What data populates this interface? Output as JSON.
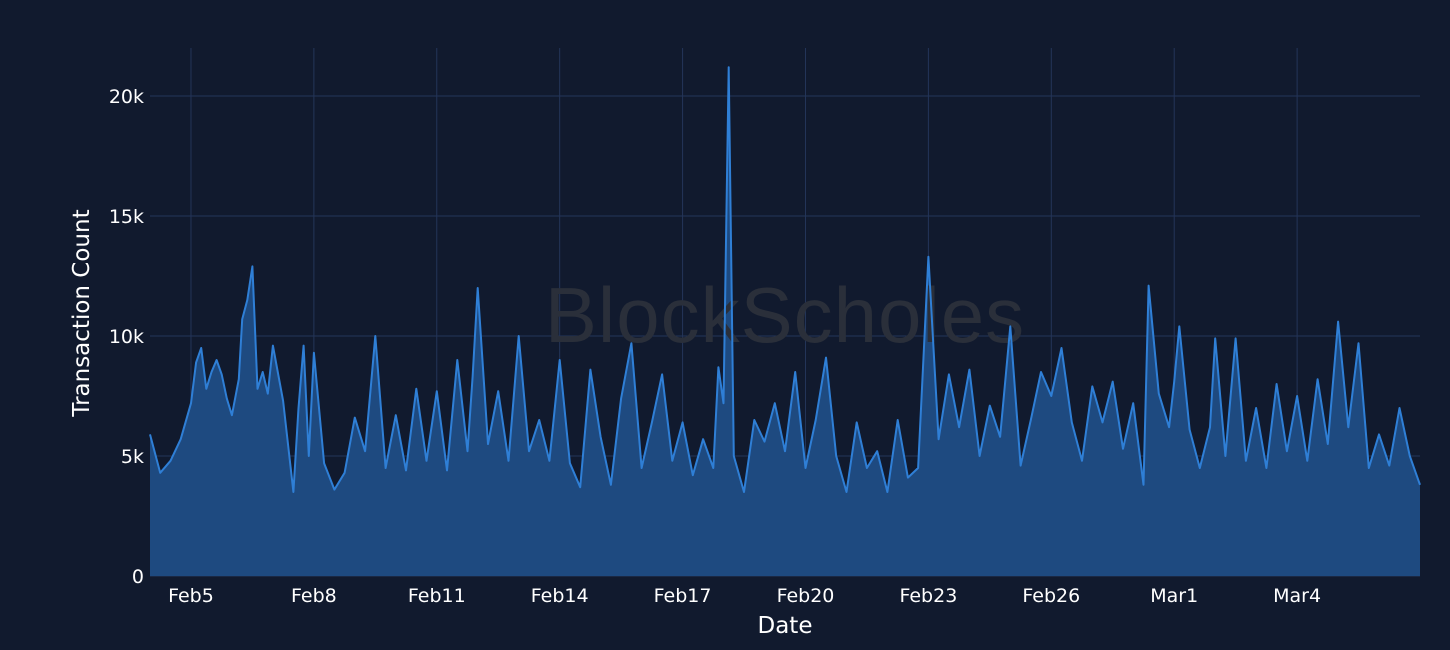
{
  "chart_data": {
    "type": "area",
    "title": "",
    "xlabel": "Date",
    "ylabel": "Transaction Count",
    "x_range": [
      "2024-02-04T00:00",
      "2024-03-06T00:00"
    ],
    "xlim": [
      "2024-02-04 00:00",
      "2024-03-06 00:00"
    ],
    "ylim": [
      0,
      22000
    ],
    "x_ticks": [
      "Feb5",
      "Feb8",
      "Feb11",
      "Feb14",
      "Feb17",
      "Feb20",
      "Feb23",
      "Feb26",
      "Mar1",
      "Mar4"
    ],
    "y_ticks": [
      "0",
      "5k",
      "10k",
      "15k",
      "20k"
    ],
    "grid": true,
    "legend": "none",
    "colors": {
      "line": "#2f7fd6",
      "fill": "#1e4a80",
      "background": "#111a2e",
      "grid": "#243559"
    },
    "series": [
      {
        "points": [
          [
            "2024-02-04 00:00",
            5900
          ],
          [
            "2024-02-04 06:00",
            4300
          ],
          [
            "2024-02-04 12:00",
            4800
          ],
          [
            "2024-02-04 18:00",
            5700
          ],
          [
            "2024-02-05 00:00",
            7200
          ],
          [
            "2024-02-05 03:00",
            8900
          ],
          [
            "2024-02-05 06:00",
            9500
          ],
          [
            "2024-02-05 09:00",
            7800
          ],
          [
            "2024-02-05 12:00",
            8500
          ],
          [
            "2024-02-05 15:00",
            9000
          ],
          [
            "2024-02-05 18:00",
            8400
          ],
          [
            "2024-02-05 21:00",
            7400
          ],
          [
            "2024-02-06 00:00",
            6700
          ],
          [
            "2024-02-06 04:00",
            8200
          ],
          [
            "2024-02-06 06:00",
            10700
          ],
          [
            "2024-02-06 09:00",
            11500
          ],
          [
            "2024-02-06 12:00",
            12900
          ],
          [
            "2024-02-06 15:00",
            7800
          ],
          [
            "2024-02-06 18:00",
            8500
          ],
          [
            "2024-02-06 21:00",
            7600
          ],
          [
            "2024-02-07 00:00",
            9600
          ],
          [
            "2024-02-07 06:00",
            7300
          ],
          [
            "2024-02-07 12:00",
            3500
          ],
          [
            "2024-02-07 15:00",
            7000
          ],
          [
            "2024-02-07 18:00",
            9600
          ],
          [
            "2024-02-07 21:00",
            5000
          ],
          [
            "2024-02-08 00:00",
            9300
          ],
          [
            "2024-02-08 06:00",
            4700
          ],
          [
            "2024-02-08 12:00",
            3600
          ],
          [
            "2024-02-08 18:00",
            4300
          ],
          [
            "2024-02-09 00:00",
            6600
          ],
          [
            "2024-02-09 06:00",
            5200
          ],
          [
            "2024-02-09 12:00",
            10000
          ],
          [
            "2024-02-09 18:00",
            4500
          ],
          [
            "2024-02-10 00:00",
            6700
          ],
          [
            "2024-02-10 06:00",
            4400
          ],
          [
            "2024-02-10 12:00",
            7800
          ],
          [
            "2024-02-10 18:00",
            4800
          ],
          [
            "2024-02-11 00:00",
            7700
          ],
          [
            "2024-02-11 06:00",
            4400
          ],
          [
            "2024-02-11 12:00",
            9000
          ],
          [
            "2024-02-11 18:00",
            5200
          ],
          [
            "2024-02-11 21:00",
            8300
          ],
          [
            "2024-02-12 00:00",
            12000
          ],
          [
            "2024-02-12 06:00",
            5500
          ],
          [
            "2024-02-12 12:00",
            7700
          ],
          [
            "2024-02-12 18:00",
            4800
          ],
          [
            "2024-02-13 00:00",
            10000
          ],
          [
            "2024-02-13 06:00",
            5200
          ],
          [
            "2024-02-13 12:00",
            6500
          ],
          [
            "2024-02-13 18:00",
            4800
          ],
          [
            "2024-02-14 00:00",
            9000
          ],
          [
            "2024-02-14 06:00",
            4700
          ],
          [
            "2024-02-14 12:00",
            3700
          ],
          [
            "2024-02-14 18:00",
            8600
          ],
          [
            "2024-02-15 00:00",
            5800
          ],
          [
            "2024-02-15 06:00",
            3800
          ],
          [
            "2024-02-15 12:00",
            7400
          ],
          [
            "2024-02-15 18:00",
            9700
          ],
          [
            "2024-02-16 00:00",
            4500
          ],
          [
            "2024-02-16 06:00",
            6400
          ],
          [
            "2024-02-16 12:00",
            8400
          ],
          [
            "2024-02-16 18:00",
            4800
          ],
          [
            "2024-02-17 00:00",
            6400
          ],
          [
            "2024-02-17 06:00",
            4200
          ],
          [
            "2024-02-17 12:00",
            5700
          ],
          [
            "2024-02-17 18:00",
            4500
          ],
          [
            "2024-02-17 21:00",
            8700
          ],
          [
            "2024-02-18 00:00",
            7200
          ],
          [
            "2024-02-18 03:00",
            21200
          ],
          [
            "2024-02-18 06:00",
            5000
          ],
          [
            "2024-02-18 12:00",
            3500
          ],
          [
            "2024-02-18 18:00",
            6500
          ],
          [
            "2024-02-19 00:00",
            5600
          ],
          [
            "2024-02-19 06:00",
            7200
          ],
          [
            "2024-02-19 12:00",
            5200
          ],
          [
            "2024-02-19 18:00",
            8500
          ],
          [
            "2024-02-20 00:00",
            4500
          ],
          [
            "2024-02-20 06:00",
            6500
          ],
          [
            "2024-02-20 12:00",
            9100
          ],
          [
            "2024-02-20 18:00",
            5000
          ],
          [
            "2024-02-21 00:00",
            3500
          ],
          [
            "2024-02-21 06:00",
            6400
          ],
          [
            "2024-02-21 12:00",
            4500
          ],
          [
            "2024-02-21 18:00",
            5200
          ],
          [
            "2024-02-22 00:00",
            3500
          ],
          [
            "2024-02-22 06:00",
            6500
          ],
          [
            "2024-02-22 12:00",
            4100
          ],
          [
            "2024-02-22 18:00",
            4500
          ],
          [
            "2024-02-23 00:00",
            13300
          ],
          [
            "2024-02-23 06:00",
            5700
          ],
          [
            "2024-02-23 12:00",
            8400
          ],
          [
            "2024-02-23 18:00",
            6200
          ],
          [
            "2024-02-24 00:00",
            8600
          ],
          [
            "2024-02-24 06:00",
            5000
          ],
          [
            "2024-02-24 12:00",
            7100
          ],
          [
            "2024-02-24 18:00",
            5800
          ],
          [
            "2024-02-25 00:00",
            10400
          ],
          [
            "2024-02-25 06:00",
            4600
          ],
          [
            "2024-02-25 12:00",
            6500
          ],
          [
            "2024-02-25 18:00",
            8500
          ],
          [
            "2024-02-26 00:00",
            7500
          ],
          [
            "2024-02-26 06:00",
            9500
          ],
          [
            "2024-02-26 12:00",
            6400
          ],
          [
            "2024-02-26 18:00",
            4800
          ],
          [
            "2024-02-27 00:00",
            7900
          ],
          [
            "2024-02-27 06:00",
            6400
          ],
          [
            "2024-02-27 12:00",
            8100
          ],
          [
            "2024-02-27 18:00",
            5300
          ],
          [
            "2024-02-28 00:00",
            7200
          ],
          [
            "2024-02-28 06:00",
            3800
          ],
          [
            "2024-02-28 09:00",
            12100
          ],
          [
            "2024-02-28 15:00",
            7600
          ],
          [
            "2024-02-28 21:00",
            6200
          ],
          [
            "2024-02-29 00:00",
            8100
          ],
          [
            "2024-02-29 03:00",
            10400
          ],
          [
            "2024-02-29 09:00",
            6100
          ],
          [
            "2024-02-29 15:00",
            4500
          ],
          [
            "2024-02-29 21:00",
            6200
          ],
          [
            "2024-03-01 00:00",
            9900
          ],
          [
            "2024-03-01 06:00",
            5000
          ],
          [
            "2024-03-01 12:00",
            9900
          ],
          [
            "2024-03-01 18:00",
            4800
          ],
          [
            "2024-03-02 00:00",
            7000
          ],
          [
            "2024-03-02 06:00",
            4500
          ],
          [
            "2024-03-02 12:00",
            8000
          ],
          [
            "2024-03-02 18:00",
            5200
          ],
          [
            "2024-03-03 00:00",
            7500
          ],
          [
            "2024-03-03 06:00",
            4800
          ],
          [
            "2024-03-03 12:00",
            8200
          ],
          [
            "2024-03-03 18:00",
            5500
          ],
          [
            "2024-03-04 00:00",
            10600
          ],
          [
            "2024-03-04 06:00",
            6200
          ],
          [
            "2024-03-04 12:00",
            9700
          ],
          [
            "2024-03-04 18:00",
            4500
          ],
          [
            "2024-03-05 00:00",
            5900
          ],
          [
            "2024-03-05 06:00",
            4600
          ],
          [
            "2024-03-05 12:00",
            7000
          ],
          [
            "2024-03-05 18:00",
            5000
          ],
          [
            "2024-03-06 00:00",
            3800
          ]
        ]
      }
    ]
  },
  "watermark": "BlockScholes"
}
